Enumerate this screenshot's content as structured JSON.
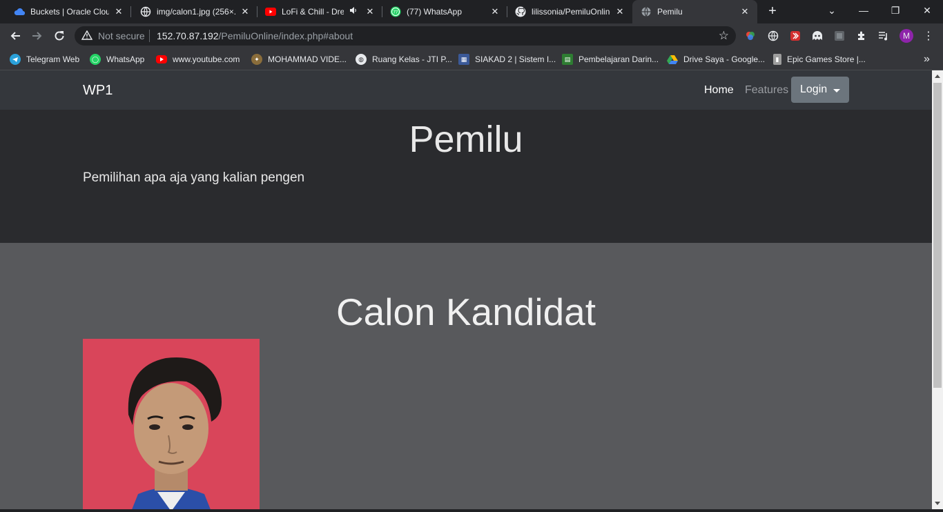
{
  "browser": {
    "tabs": [
      {
        "title": "Buckets | Oracle Cloud",
        "icon": "cloud-icon",
        "color": "#4285f4"
      },
      {
        "title": "img/calon1.jpg (256×...",
        "icon": "globe-icon",
        "color": "#e8eaed"
      },
      {
        "title": "LoFi & Chill - Dre",
        "icon": "youtube-icon",
        "color": "#ff0000"
      },
      {
        "title": "(77) WhatsApp",
        "icon": "whatsapp-icon",
        "color": "#25d366"
      },
      {
        "title": "lilissonia/PemiluOnline",
        "icon": "github-icon",
        "color": "#e8eaed"
      },
      {
        "title": "Pemilu",
        "icon": "globe-icon",
        "color": "#e8eaed"
      }
    ],
    "whatsapp_badge": "77",
    "new_tab": "+",
    "window_controls": {
      "tab_search": "⌄",
      "minimize": "—",
      "restore": "❐",
      "close": "✕"
    },
    "omnibox": {
      "security_label": "Not secure",
      "url_host": "152.70.87.192",
      "url_path": "/PemiluOnline/index.php#about"
    },
    "profile_initial": "M",
    "bookmarks": [
      {
        "label": "Telegram Web",
        "icon": "telegram-icon",
        "color": "#2aa1da"
      },
      {
        "label": "WhatsApp",
        "icon": "whatsapp-icon",
        "color": "#25d366"
      },
      {
        "label": "www.youtube.com",
        "icon": "youtube-icon",
        "color": "#ff0000"
      },
      {
        "label": "MOHAMMAD VIDE...",
        "icon": "seal-icon",
        "color": "#8a6d3b"
      },
      {
        "label": "Ruang Kelas - JTI P...",
        "icon": "globe-icon",
        "color": "#e8eaed"
      },
      {
        "label": "SIAKAD 2 | Sistem I...",
        "icon": "university-icon",
        "color": "#3b5998"
      },
      {
        "label": "Pembelajaran Darin...",
        "icon": "moodle-icon",
        "color": "#2e7d32"
      },
      {
        "label": "Drive Saya - Google...",
        "icon": "drive-icon",
        "color": "#fbbc04"
      },
      {
        "label": "Epic Games Store |...",
        "icon": "epic-icon",
        "color": "#9e9e9e"
      }
    ],
    "bookmarks_overflow": "»"
  },
  "page": {
    "brand": "WP1",
    "nav": {
      "home": "Home",
      "features": "Features",
      "login": "Login"
    },
    "hero": {
      "title": "Pemilu",
      "subtitle": "Pemilihan apa aja yang kalian pengen"
    },
    "section_title": "Calon Kandidat"
  },
  "colors": {
    "navbar_bg": "#34373c",
    "hero_bg": "#2a2b2e",
    "section_bg": "#58595c",
    "login_bg": "#6c757d",
    "photo_bg": "#d9455a"
  }
}
